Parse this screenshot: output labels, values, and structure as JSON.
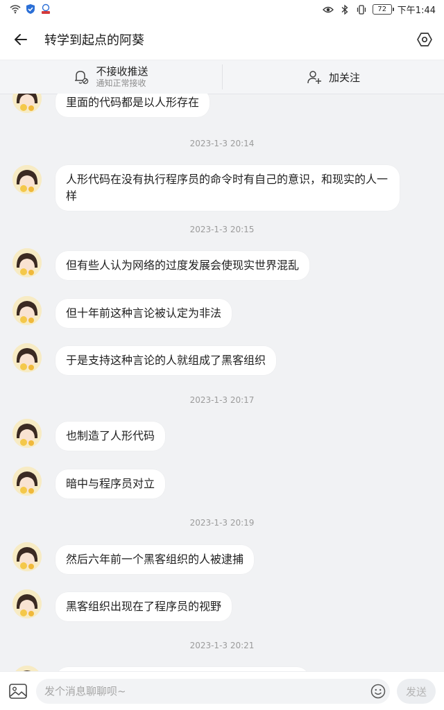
{
  "status_bar": {
    "time": "下午1:44",
    "battery": "72"
  },
  "header": {
    "title": "转学到起点的阿葵"
  },
  "action_bar": {
    "mute_title": "不接收推送",
    "mute_subtitle": "通知正常接收",
    "follow_label": "加关注"
  },
  "chat": {
    "items": [
      {
        "kind": "message",
        "text": "里面的代码都是以人形存在"
      },
      {
        "kind": "timestamp",
        "text": "2023-1-3 20:14"
      },
      {
        "kind": "message",
        "text": "人形代码在没有执行程序员的命令时有自己的意识，和现实的人一样"
      },
      {
        "kind": "timestamp",
        "text": "2023-1-3 20:15"
      },
      {
        "kind": "message",
        "text": "但有些人认为网络的过度发展会使现实世界混乱"
      },
      {
        "kind": "message",
        "text": "但十年前这种言论被认定为非法"
      },
      {
        "kind": "message",
        "text": "于是支持这种言论的人就组成了黑客组织"
      },
      {
        "kind": "timestamp",
        "text": "2023-1-3 20:17"
      },
      {
        "kind": "message",
        "text": "也制造了人形代码"
      },
      {
        "kind": "message",
        "text": "暗中与程序员对立"
      },
      {
        "kind": "timestamp",
        "text": "2023-1-3 20:19"
      },
      {
        "kind": "message",
        "text": "然后六年前一个黑客组织的人被逮捕"
      },
      {
        "kind": "message",
        "text": "黑客组织出现在了程序员的视野"
      },
      {
        "kind": "timestamp",
        "text": "2023-1-3 20:21"
      }
    ]
  },
  "input_bar": {
    "placeholder": "发个消息聊聊呗~",
    "value": "",
    "send_label": "发送"
  },
  "icons": {
    "back": "arrow-left-icon",
    "settings": "hexagon-gear-icon",
    "mute": "bell-off-icon",
    "follow": "add-user-icon",
    "image": "image-icon",
    "emoji": "smiley-icon"
  },
  "colors": {
    "background": "#f1f2f4",
    "bubble": "#ffffff",
    "muted_text": "#9b9b9b"
  }
}
